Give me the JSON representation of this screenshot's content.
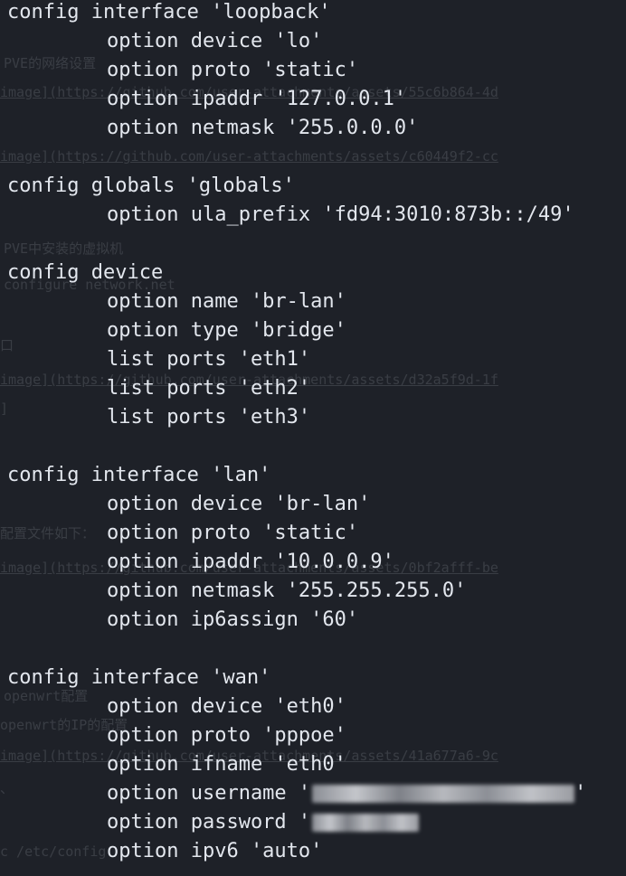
{
  "background_text": [
    "PVE的网络设置",
    "image](https://github.com/user-attachments/assets/55c6b864-4d",
    "image](https://github.com/user-attachments/assets/c60449f2-cc",
    "PVE中安装的虚拟机",
    "configure network.net",
    "口",
    "image](https://github.com/user-attachments/assets/d32a5f9d-1f",
    "]",
    "配置文件如下：",
    "image](https://github.com/user-attachments/assets/0bf2afff-be",
    "openwrt配置",
    "openwrt的IP的配置",
    "image](https://github.com/user-attachments/assets/41a677a6-9c",
    "、",
    "c /etc/config"
  ],
  "code_lines": [
    {
      "indent": false,
      "text": "config interface 'loopback'"
    },
    {
      "indent": true,
      "text": "option device 'lo'"
    },
    {
      "indent": true,
      "text": "option proto 'static'"
    },
    {
      "indent": true,
      "text": "option ipaddr '127.0.0.1'"
    },
    {
      "indent": true,
      "text": "option netmask '255.0.0.0'"
    },
    {
      "blank": true
    },
    {
      "indent": false,
      "text": "config globals 'globals'"
    },
    {
      "indent": true,
      "text": "option ula_prefix 'fd94:3010:873b::/49'"
    },
    {
      "blank": true
    },
    {
      "indent": false,
      "text": "config device"
    },
    {
      "indent": true,
      "text": "option name 'br-lan'"
    },
    {
      "indent": true,
      "text": "option type 'bridge'"
    },
    {
      "indent": true,
      "text": "list ports 'eth1'"
    },
    {
      "indent": true,
      "text": "list ports 'eth2'"
    },
    {
      "indent": true,
      "text": "list ports 'eth3'"
    },
    {
      "blank": true
    },
    {
      "indent": false,
      "text": "config interface 'lan'"
    },
    {
      "indent": true,
      "text": "option device 'br-lan'"
    },
    {
      "indent": true,
      "text": "option proto 'static'"
    },
    {
      "indent": true,
      "text": "option ipaddr '10.0.0.9'"
    },
    {
      "indent": true,
      "text": "option netmask '255.255.255.0'"
    },
    {
      "indent": true,
      "text": "option ip6assign '60'"
    },
    {
      "blank": true
    },
    {
      "indent": false,
      "text": "config interface 'wan'"
    },
    {
      "indent": true,
      "text": "option device 'eth0'"
    },
    {
      "indent": true,
      "text": "option proto 'pppoe'"
    },
    {
      "indent": true,
      "text": "option ifname 'eth0'"
    },
    {
      "indent": true,
      "text": "option username '",
      "redacted": "username",
      "suffix": "'"
    },
    {
      "indent": true,
      "text": "option password '",
      "redacted": "password"
    },
    {
      "indent": true,
      "text": "option ipv6 'auto'"
    }
  ],
  "colors": {
    "background": "#1e2128",
    "text": "#e3e7ee",
    "redaction": "#a9abb0"
  }
}
